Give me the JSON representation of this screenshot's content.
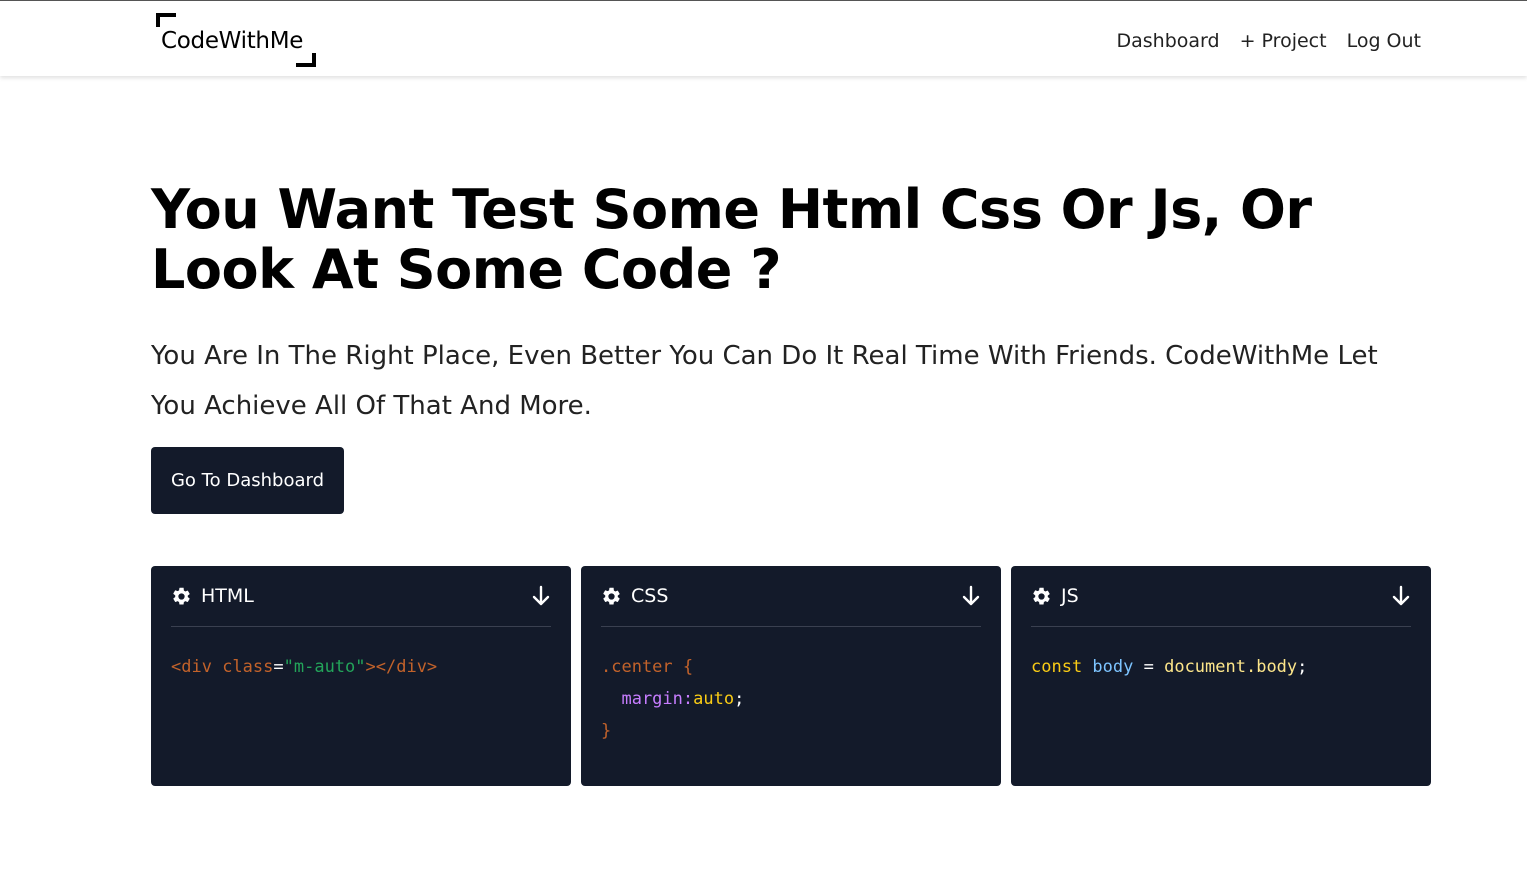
{
  "navbar": {
    "logo_text": "CodeWithMe",
    "links": [
      {
        "label": "Dashboard"
      },
      {
        "label": "+ Project"
      },
      {
        "label": "Log Out"
      }
    ]
  },
  "hero": {
    "title": "You Want Test Some Html Css Or Js, Or Look At Some Code ?",
    "subtitle": "You Are In The Right Place, Even Better You Can Do It Real Time With Friends. CodeWithMe Let You Achieve All Of That And More.",
    "cta_label": "Go To Dashboard"
  },
  "cards": [
    {
      "title": "HTML",
      "icon": "gear-icon",
      "action_icon": "arrow-down-icon",
      "code": {
        "open_tag": "<div",
        "attr": " class",
        "eq": "=",
        "str": "\"m-auto\"",
        "close_tag": "></div>"
      }
    },
    {
      "title": "CSS",
      "icon": "gear-icon",
      "action_icon": "arrow-down-icon",
      "code": {
        "selector": ".center {",
        "prop": "  margin:",
        "value": "auto",
        "semi": ";",
        "brace": "}"
      }
    },
    {
      "title": "JS",
      "icon": "gear-icon",
      "action_icon": "arrow-down-icon",
      "code": {
        "kw": "const",
        "var": " body",
        "op": " = ",
        "obj": "document.body",
        "semi": ";"
      }
    }
  ],
  "colors": {
    "dark": "#131a2a",
    "tag": "#c2622a",
    "string": "#23a45a",
    "property": "#c77dff",
    "keyword": "#facc15",
    "variable": "#7dc4ff"
  }
}
